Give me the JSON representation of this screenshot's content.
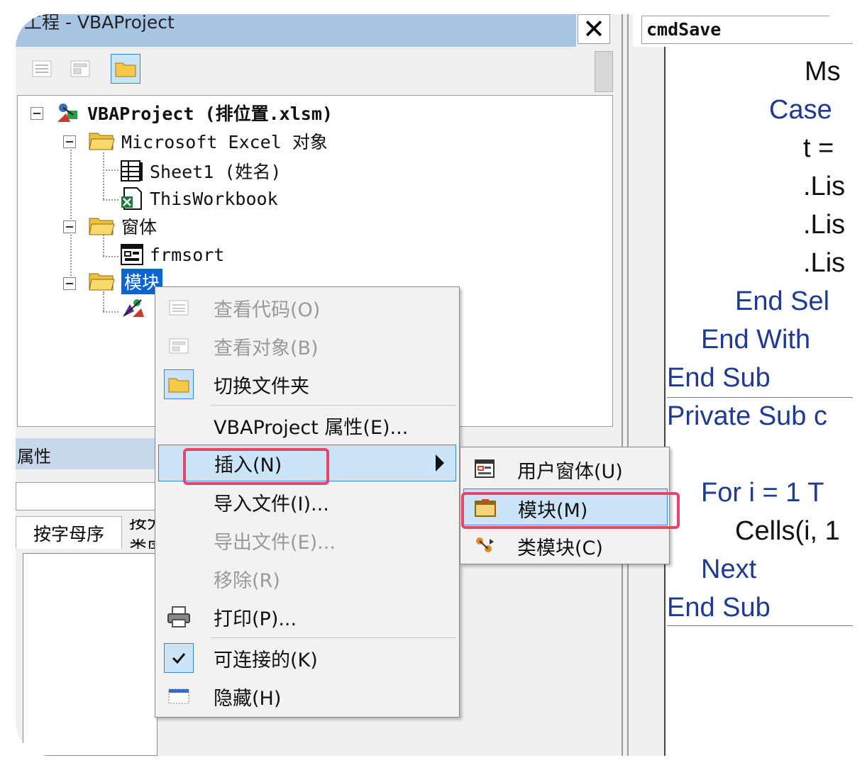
{
  "project_window": {
    "title": "工程 - VBAProject",
    "close_glyph": "✕",
    "tree": {
      "root": "VBAProject (排位置.xlsm)",
      "excel_objects": "Microsoft Excel 对象",
      "sheet1": "Sheet1 (姓名)",
      "this_workbook": "ThisWorkbook",
      "forms": "窗体",
      "frmsort": "frmsort",
      "modules": "模块"
    }
  },
  "properties": {
    "title": "属性",
    "tab_alpha": "按字母序",
    "tab_category": "按分类序"
  },
  "code_window": {
    "object_combo": "cmdSave",
    "lines": [
      {
        "text": "Ms",
        "color": "#111111"
      },
      {
        "text": "Case",
        "color": "#1f3a93"
      },
      {
        "text": "t =",
        "color": "#111111"
      },
      {
        "text": ".Lis",
        "color": "#111111"
      },
      {
        "text": ".Lis",
        "color": "#111111"
      },
      {
        "text": ".Lis",
        "color": "#111111"
      },
      {
        "text": "End Sel",
        "color": "#1f3a93"
      },
      {
        "text": "End With",
        "color": "#1f3a93"
      },
      {
        "text": "End Sub",
        "color": "#1f3a93"
      },
      {
        "text": "Private Sub c",
        "color": "#1f3a93"
      },
      {
        "text": "For i = 1 T",
        "color": "#1f3a93"
      },
      {
        "text": "Cells(i, 1",
        "color": "#111111"
      },
      {
        "text": "Next",
        "color": "#1f3a93"
      },
      {
        "text": "End Sub",
        "color": "#1f3a93"
      }
    ]
  },
  "context_menu": {
    "view_code": "查看代码(O)",
    "view_object": "查看对象(B)",
    "toggle_folders": "切换文件夹",
    "project_properties": "VBAProject 属性(E)...",
    "insert": "插入(N)",
    "import_file": "导入文件(I)...",
    "export_file": "导出文件(E)...",
    "remove": "移除(R)",
    "print": "打印(P)...",
    "dockable": "可连接的(K)",
    "hide": "隐藏(H)"
  },
  "insert_submenu": {
    "userform": "用户窗体(U)",
    "module": "模块(M)",
    "class_module": "类模块(C)"
  },
  "colors": {
    "highlight_bg": "#cce4f7",
    "highlight_border": "#3a87d1",
    "annotation_red": "#e8456a",
    "keyword_blue": "#1f3a93",
    "selection_blue": "#0a64d6"
  }
}
